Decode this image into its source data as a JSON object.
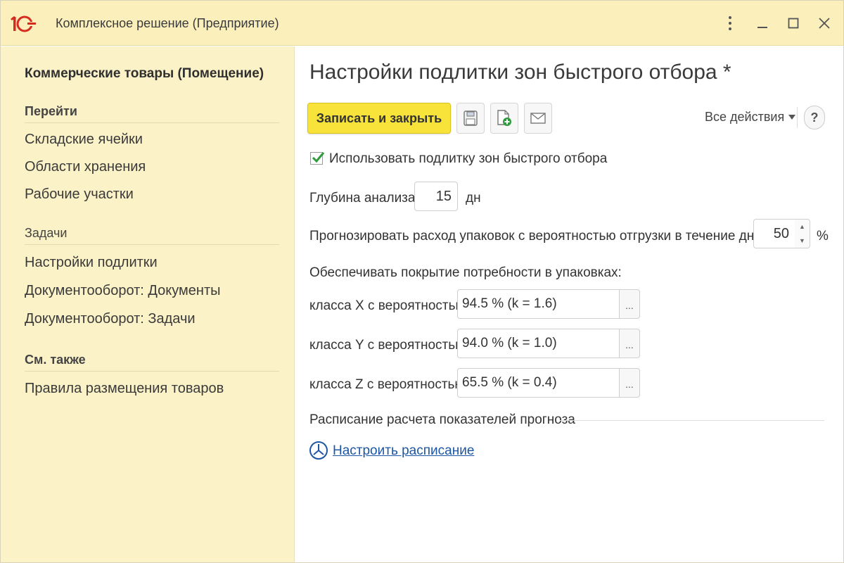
{
  "window": {
    "title": "Комплексное решение (Предприятие)",
    "logo_text": "1С"
  },
  "sidebar": {
    "title": "Коммерческие товары (Помещение)",
    "sections": [
      {
        "label": "Перейти",
        "items": [
          "Складские ячейки",
          "Области хранения",
          "Рабочие участки"
        ]
      },
      {
        "label": "Задачи",
        "items": [
          "Настройки подлитки",
          "Документооборот: Документы",
          "Документооборот: Задачи"
        ]
      },
      {
        "label": "См. также",
        "items": [
          "Правила размещения товаров"
        ]
      }
    ]
  },
  "main": {
    "page_title": "Настройки подлитки зон быстрого отбора *",
    "toolbar": {
      "save_close_label": "Записать и закрыть",
      "all_actions_label": "Все действия",
      "help_label": "?"
    },
    "use_replenishment": {
      "checked": true,
      "label": "Использовать подлитку зон быстрого отбора"
    },
    "analysis_depth": {
      "label": "Глубина анализа:",
      "value": "15",
      "unit": "дн"
    },
    "forecast": {
      "label": "Прогнозировать расход упаковок с вероятностью отгрузки в течение дня более:",
      "value": "50",
      "unit": "%"
    },
    "coverage": {
      "label": "Обеспечивать покрытие потребности в упаковках:",
      "rows": [
        {
          "label": "класса X с вероятностью:",
          "value": "94.5 % (k = 1.6)"
        },
        {
          "label": "класса Y с вероятностью:",
          "value": "94.0 % (k = 1.0)"
        },
        {
          "label": "класса Z с вероятностью:",
          "value": "65.5 % (k = 0.4)"
        }
      ],
      "select_button_label": "..."
    },
    "schedule": {
      "label": "Расписание расчета показателей прогноза",
      "link_label": "Настроить расписание"
    }
  },
  "colors": {
    "titlebar_bg": "#fbf0bc",
    "sidebar_bg": "#fcf2c7",
    "primary_button": "#f8e33a",
    "link": "#1d56a5",
    "logo_red": "#d62b1f",
    "check_green": "#2e9b3c"
  }
}
